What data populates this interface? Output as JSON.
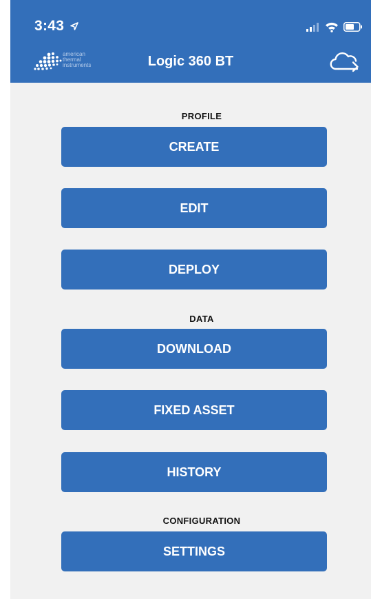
{
  "status_bar": {
    "time": "3:43",
    "icons": [
      "location-arrow-icon",
      "signal-icon",
      "wifi-icon",
      "battery-icon"
    ]
  },
  "header": {
    "brand_logo_text": "american\nthermal\ninstruments",
    "title": "Logic 360 BT",
    "cloud_icon": "cloud-sync-icon"
  },
  "sections": {
    "profile": {
      "label": "PROFILE",
      "buttons": [
        "CREATE",
        "EDIT",
        "DEPLOY"
      ]
    },
    "data": {
      "label": "DATA",
      "buttons": [
        "DOWNLOAD",
        "FIXED ASSET",
        "HISTORY"
      ]
    },
    "configuration": {
      "label": "CONFIGURATION",
      "buttons": [
        "SETTINGS"
      ]
    }
  },
  "colors": {
    "primary": "#336fba",
    "background": "#f1f1f1",
    "button_text": "#ffffff",
    "label_text": "#111111"
  }
}
